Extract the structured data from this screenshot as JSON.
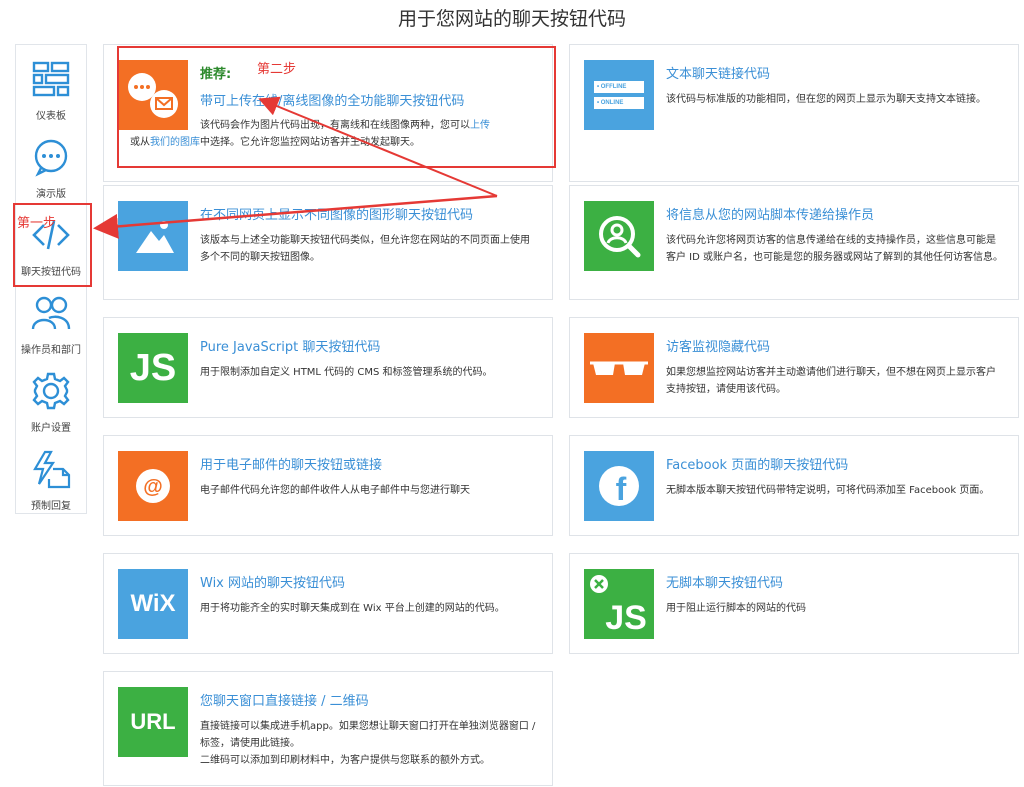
{
  "page": {
    "title": "用于您网站的聊天按钮代码"
  },
  "sidebar": {
    "items": [
      {
        "label": "仪表板",
        "icon": "dashboard-icon"
      },
      {
        "label": "演示版",
        "icon": "chat-bubble-icon"
      },
      {
        "label": "聊天按钮代码",
        "icon": "code-icon"
      },
      {
        "label": "操作员和部门",
        "icon": "users-icon"
      },
      {
        "label": "账户设置",
        "icon": "gear-icon"
      },
      {
        "label": "预制回复",
        "icon": "document-lightning-icon"
      }
    ]
  },
  "annotations": {
    "step1": "第一步",
    "step2": "第二步",
    "color": "#e53935"
  },
  "cards": {
    "full_featured": {
      "recommend": "推荐:",
      "title": "带可上传在线/离线图像的全功能聊天按钮代码",
      "desc_a": "该代码会作为图片代码出现，有离线和在线图像两种，您可以",
      "desc_link1": "上传",
      "desc_b": "或从",
      "desc_link2": "我们的图库",
      "desc_c": "中选择。它允许您监控网站访客并主动发起聊天。"
    },
    "text_link": {
      "title": "文本聊天链接代码",
      "desc": "该代码与标准版的功能相同，但在您的网页上显示为聊天支持文本链接。",
      "thumb_offline": "• OFFLINE",
      "thumb_online": "• ONLINE"
    },
    "graphic_diff": {
      "title": "在不同网页上显示不同图像的图形聊天按钮代码",
      "desc": "该版本与上述全功能聊天按钮代码类似，但允许您在网站的不同页面上使用多个不同的聊天按钮图像。"
    },
    "pass_info": {
      "title": "将信息从您的网站脚本传递给操作员",
      "desc": "该代码允许您将网页访客的信息传递给在线的支持操作员，这些信息可能是客户 ID 或账户名，也可能是您的服务器或网站了解到的其他任何访客信息。"
    },
    "pure_js": {
      "title": "Pure JavaScript 聊天按钮代码",
      "desc": "用于限制添加自定义 HTML 代码的 CMS 和标签管理系统的代码。",
      "thumb": "JS"
    },
    "hidden_monitor": {
      "title": "访客监视隐藏代码",
      "desc": "如果您想监控网站访客并主动邀请他们进行聊天，但不想在网页上显示客户支持按钮，请使用该代码。"
    },
    "email": {
      "title": "用于电子邮件的聊天按钮或链接",
      "desc": "电子邮件代码允许您的邮件收件人从电子邮件中与您进行聊天",
      "thumb": "@"
    },
    "facebook": {
      "title": "Facebook 页面的聊天按钮代码",
      "desc": "无脚本版本聊天按钮代码带特定说明，可将代码添加至 Facebook 页面。",
      "thumb": "f"
    },
    "wix": {
      "title": "Wix 网站的聊天按钮代码",
      "desc": "用于将功能齐全的实时聊天集成到在 Wix 平台上创建的网站的代码。",
      "thumb": "WiX"
    },
    "noscript": {
      "title": "无脚本聊天按钮代码",
      "desc": "用于阻止运行脚本的网站的代码",
      "thumb": "JS"
    },
    "direct_link": {
      "title": "您聊天窗口直接链接 / 二维码",
      "desc1": "直接链接可以集成进手机app。如果您想让聊天窗口打开在单独浏览器窗口 / 标签，请使用此链接。",
      "desc2": "二维码可以添加到印刷材料中，为客户提供与您联系的额外方式。",
      "thumb": "URL"
    }
  },
  "colors": {
    "orange": "#f36f24",
    "blue": "#4aa3df",
    "green": "#3cb043",
    "link": "#3a8fd6",
    "icon_blue": "#2d8fd6"
  }
}
